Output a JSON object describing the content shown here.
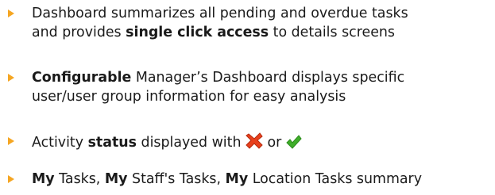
{
  "bullets": [
    {
      "line1": "Dashboard summarizes all pending and overdue tasks",
      "line2_a": "and provides ",
      "line2_b": "single click access",
      "line2_c": " to details screens"
    },
    {
      "line1_b": "Configurable",
      "line1_c": " Manager’s Dashboard displays specific",
      "line2": "user/user group information for easy analysis"
    },
    {
      "a": "Activity ",
      "b": "status",
      "c": " displayed with ",
      "d": " or ",
      "icons": [
        "cross-icon",
        "check-icon"
      ],
      "colors": {
        "cross": "#e8401c",
        "check": "#3fae2a"
      }
    },
    {
      "b1": "My",
      "t1": " Tasks, ",
      "b2": "My",
      "t2": " Staff's Tasks, ",
      "b3": "My",
      "t3": " Location Tasks summary"
    }
  ],
  "accent": "#f5a623"
}
